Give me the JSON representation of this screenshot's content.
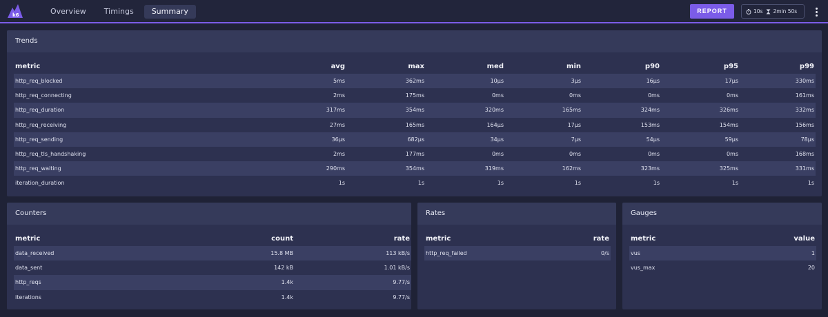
{
  "app": {
    "logo_text": "k6"
  },
  "nav": {
    "tabs": [
      "Overview",
      "Timings",
      "Summary"
    ],
    "active": "Summary"
  },
  "toolbar": {
    "report_label": "REPORT",
    "interval": "10s",
    "duration": "2min 50s"
  },
  "trends": {
    "title": "Trends",
    "columns": [
      "metric",
      "avg",
      "max",
      "med",
      "min",
      "p90",
      "p95",
      "p99"
    ],
    "rows": [
      [
        "http_req_blocked",
        "5ms",
        "362ms",
        "10µs",
        "3µs",
        "16µs",
        "17µs",
        "330ms"
      ],
      [
        "http_req_connecting",
        "2ms",
        "175ms",
        "0ms",
        "0ms",
        "0ms",
        "0ms",
        "161ms"
      ],
      [
        "http_req_duration",
        "317ms",
        "354ms",
        "320ms",
        "165ms",
        "324ms",
        "326ms",
        "332ms"
      ],
      [
        "http_req_receiving",
        "27ms",
        "165ms",
        "164µs",
        "17µs",
        "153ms",
        "154ms",
        "156ms"
      ],
      [
        "http_req_sending",
        "36µs",
        "682µs",
        "34µs",
        "7µs",
        "54µs",
        "59µs",
        "78µs"
      ],
      [
        "http_req_tls_handshaking",
        "2ms",
        "177ms",
        "0ms",
        "0ms",
        "0ms",
        "0ms",
        "168ms"
      ],
      [
        "http_req_waiting",
        "290ms",
        "354ms",
        "319ms",
        "162ms",
        "323ms",
        "325ms",
        "331ms"
      ],
      [
        "iteration_duration",
        "1s",
        "1s",
        "1s",
        "1s",
        "1s",
        "1s",
        "1s"
      ]
    ]
  },
  "counters": {
    "title": "Counters",
    "columns": [
      "metric",
      "count",
      "rate"
    ],
    "rows": [
      [
        "data_received",
        "15.8 MB",
        "113 kB/s"
      ],
      [
        "data_sent",
        "142 kB",
        "1.01 kB/s"
      ],
      [
        "http_reqs",
        "1.4k",
        "9.77/s"
      ],
      [
        "iterations",
        "1.4k",
        "9.77/s"
      ]
    ]
  },
  "rates": {
    "title": "Rates",
    "columns": [
      "metric",
      "rate"
    ],
    "rows": [
      [
        "http_req_failed",
        "0/s"
      ]
    ]
  },
  "gauges": {
    "title": "Gauges",
    "columns": [
      "metric",
      "value"
    ],
    "rows": [
      [
        "vus",
        "1"
      ],
      [
        "vus_max",
        "20"
      ]
    ]
  },
  "colors": {
    "accent": "#7b5ce8",
    "card": "#2d3150",
    "card_header": "#353a5a",
    "row_stripe": "#3a3f63"
  }
}
